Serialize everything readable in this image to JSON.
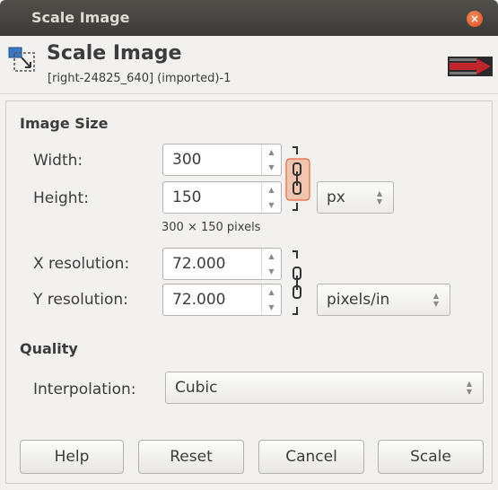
{
  "window": {
    "title": "Scale Image"
  },
  "header": {
    "title": "Scale Image",
    "subtitle": "[right-24825_640] (imported)-1",
    "icon": "scale-image-icon"
  },
  "image_size": {
    "heading": "Image Size",
    "width_label": "Width:",
    "width_value": "300",
    "height_label": "Height:",
    "height_value": "150",
    "unit": "px",
    "pixels_text": "300 × 150 pixels",
    "size_chain_linked": true
  },
  "resolution": {
    "x_label": "X resolution:",
    "x_value": "72.000",
    "y_label": "Y resolution:",
    "y_value": "72.000",
    "unit": "pixels/in",
    "res_chain_linked": true
  },
  "quality": {
    "heading": "Quality",
    "interpolation_label": "Interpolation:",
    "interpolation_value": "Cubic"
  },
  "buttons": {
    "help": "Help",
    "reset": "Reset",
    "cancel": "Cancel",
    "scale": "Scale"
  },
  "colors": {
    "titlebar": "#3c3b37",
    "close": "#df4a16",
    "chain_highlight": "#f3c4ae"
  }
}
